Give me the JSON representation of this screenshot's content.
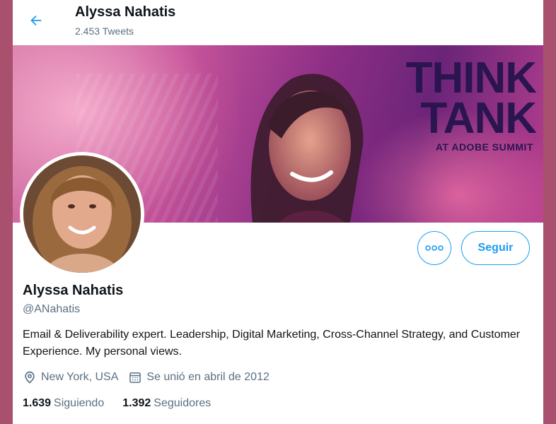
{
  "header": {
    "title": "Alyssa Nahatis",
    "tweet_count": "2.453 Tweets"
  },
  "banner": {
    "line1": "THINK",
    "line2": "TANK",
    "line3": "AT ADOBE SUMMIT"
  },
  "actions": {
    "follow_label": "Seguir",
    "more_icon": "more-dots-icon"
  },
  "profile": {
    "name": "Alyssa Nahatis",
    "handle": "@ANahatis",
    "bio": "Email & Deliverability expert. Leadership, Digital Marketing, Cross-Channel Strategy, and Customer Experience. My personal views.",
    "location": "New York, USA",
    "joined": "Se unió en abril de 2012"
  },
  "stats": {
    "following_count": "1.639",
    "following_label": "Siguiendo",
    "followers_count": "1.392",
    "followers_label": "Seguidores"
  },
  "colors": {
    "accent": "#1d9bf0",
    "secondary_text": "#5b7083",
    "page_background": "#a8506e"
  }
}
